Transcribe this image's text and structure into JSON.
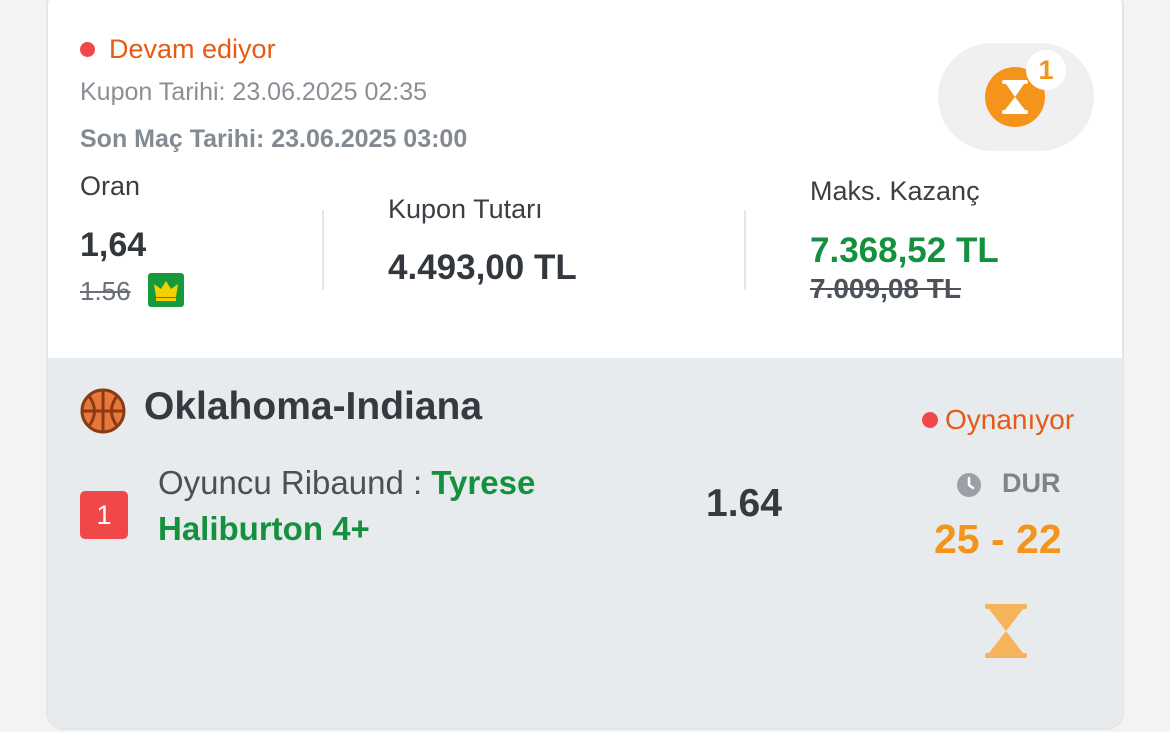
{
  "coupon": {
    "status": "Devam ediyor",
    "coupon_date": "Kupon Tarihi: 23.06.2025 02:35",
    "last_match_date": "Son Maç Tarihi: 23.06.2025 03:00",
    "pending_count": "1",
    "odds_label": "Oran",
    "odds_value": "1,64",
    "odds_old": "1.56",
    "amount_label": "Kupon Tutarı",
    "amount_value": "4.493,00 TL",
    "max_win_label": "Maks. Kazanç",
    "max_win_value": "7.368,52 TL",
    "max_win_old": "7.009,08 TL"
  },
  "match": {
    "name": "Oklahoma-Indiana",
    "live_status": "Oynanıyor",
    "selection_number": "1",
    "market": "Oyuncu Ribaund : ",
    "pick_line1": "Tyrese",
    "pick_line2": "Haliburton 4+",
    "odds": "1.64",
    "period": "DUR",
    "score": "25 - 22"
  },
  "icons": {
    "pending": "hourglass-icon",
    "sport": "basketball-icon",
    "boost": "crown-icon",
    "clock": "clock-icon",
    "result": "hourglass-icon"
  },
  "colors": {
    "live_red": "#f04848",
    "status_orange": "#e55a14",
    "win_green": "#13913d",
    "pending_orange": "#f4941b",
    "section_gray": "#e7ebed"
  }
}
